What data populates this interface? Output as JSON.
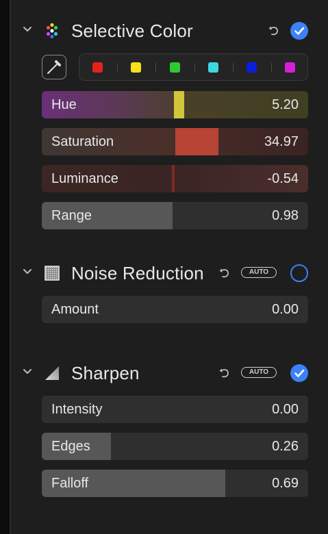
{
  "selective_color": {
    "title": "Selective Color",
    "swatches": [
      "#e2231a",
      "#f5e11c",
      "#31c832",
      "#3fd7e0",
      "#0a1fd9",
      "#d320d6"
    ],
    "sliders": {
      "hue": {
        "label": "Hue",
        "value": "5.20",
        "color": "#d2c63b"
      },
      "saturation": {
        "label": "Saturation",
        "value": "34.97",
        "color": "#b74435"
      },
      "luminance": {
        "label": "Luminance",
        "value": "-0.54",
        "color": "#7d2a24"
      },
      "range": {
        "label": "Range",
        "value": "0.98",
        "level": 0.49
      }
    },
    "enabled": true
  },
  "noise_reduction": {
    "title": "Noise Reduction",
    "auto_label": "AUTO",
    "enabled": false,
    "sliders": {
      "amount": {
        "label": "Amount",
        "value": "0.00",
        "level": 0
      }
    }
  },
  "sharpen": {
    "title": "Sharpen",
    "auto_label": "AUTO",
    "enabled": true,
    "sliders": {
      "intensity": {
        "label": "Intensity",
        "value": "0.00",
        "level": 0
      },
      "edges": {
        "label": "Edges",
        "value": "0.26",
        "level": 0.26
      },
      "falloff": {
        "label": "Falloff",
        "value": "0.69",
        "level": 0.69
      }
    }
  },
  "colors": {
    "accent": "#3b82f6",
    "slider_track": "#2f2f2f",
    "slider_fill": "#575757"
  },
  "icons": {
    "collapse": "chevron-down-icon",
    "selective_color": "color-dots-icon",
    "noise_reduction": "noise-square-icon",
    "sharpen": "sharpen-triangle-icon",
    "reset": "undo-icon",
    "eyedropper": "eyedropper-icon",
    "enabled": "checkmark-circle-icon"
  }
}
